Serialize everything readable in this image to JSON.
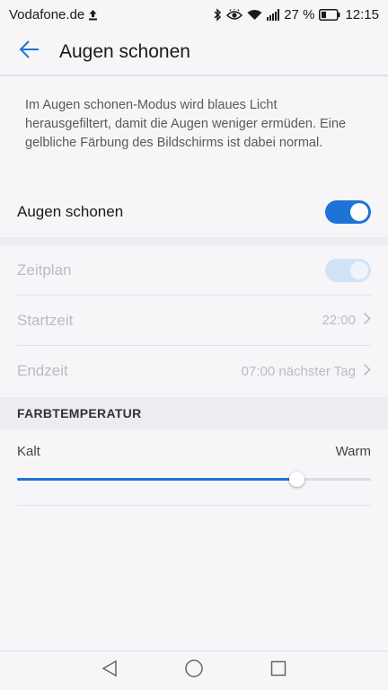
{
  "statusbar": {
    "carrier": "Vodafone.de",
    "battery_percent": "27 %",
    "time": "12:15",
    "icons": [
      "upload-icon",
      "bluetooth-icon",
      "eye-icon",
      "wifi-icon",
      "signal-icon",
      "battery-icon"
    ]
  },
  "appbar": {
    "title": "Augen schonen",
    "back_icon": "back-arrow-icon"
  },
  "description": "Im Augen schonen-Modus wird blaues Licht herausgefiltert, damit die Augen weniger ermüden. Eine gelbliche Färbung des Bildschirms ist dabei normal.",
  "settings": {
    "main_toggle": {
      "label": "Augen schonen",
      "on": true
    },
    "schedule": {
      "label": "Zeitplan",
      "on": true,
      "enabled": false
    },
    "start_time": {
      "label": "Startzeit",
      "value": "22:00"
    },
    "end_time": {
      "label": "Endzeit",
      "value": "07:00 nächster Tag"
    }
  },
  "color_temperature": {
    "header": "FARBTEMPERATUR",
    "min_label": "Kalt",
    "max_label": "Warm",
    "value_fraction": 0.79
  },
  "navbar": {
    "icons": [
      "back-triangle-icon",
      "home-circle-icon",
      "recents-square-icon"
    ]
  },
  "colors": {
    "accent": "#1e74d6",
    "background": "#f7f5f8",
    "disabled_text": "#bdbbc0"
  }
}
